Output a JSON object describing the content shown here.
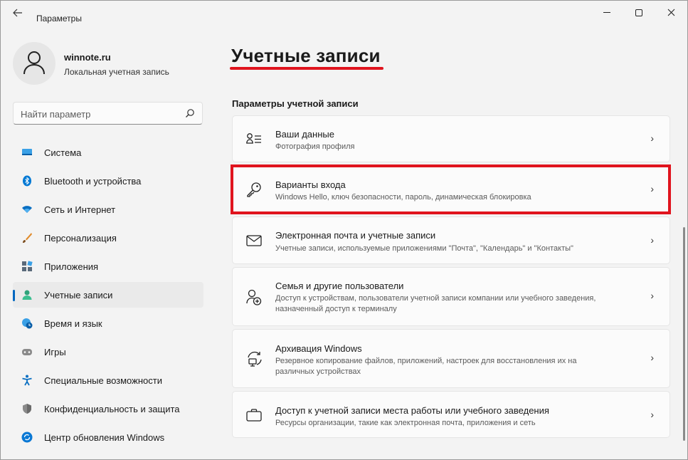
{
  "titlebar": {
    "back_icon": "back-arrow-icon",
    "title": "Параметры"
  },
  "user": {
    "name": "winnote.ru",
    "account_type": "Локальная учетная запись",
    "avatar_icon": "person-icon"
  },
  "search": {
    "placeholder": "Найти параметр",
    "icon": "search-icon"
  },
  "nav": {
    "items": [
      {
        "label": "Система",
        "icon": "system-icon",
        "color": "#0078d4"
      },
      {
        "label": "Bluetooth и устройства",
        "icon": "bluetooth-icon",
        "color": "#0078d4"
      },
      {
        "label": "Сеть и Интернет",
        "icon": "wifi-icon",
        "color": "#0078d4"
      },
      {
        "label": "Персонализация",
        "icon": "brush-icon",
        "color": "#e08a2a"
      },
      {
        "label": "Приложения",
        "icon": "apps-icon",
        "color": "#5a6a7a"
      },
      {
        "label": "Учетные записи",
        "icon": "accounts-icon",
        "color": "#2fa37a",
        "active": true
      },
      {
        "label": "Время и язык",
        "icon": "time-language-icon",
        "color": "#0078d4"
      },
      {
        "label": "Игры",
        "icon": "gamepad-icon",
        "color": "#7a7a7a"
      },
      {
        "label": "Специальные возможности",
        "icon": "accessibility-icon",
        "color": "#0078d4"
      },
      {
        "label": "Конфиденциальность и защита",
        "icon": "shield-icon",
        "color": "#7a7a7a"
      },
      {
        "label": "Центр обновления Windows",
        "icon": "update-icon",
        "color": "#0078d4"
      }
    ]
  },
  "main": {
    "title": "Учетные записи",
    "section_title": "Параметры учетной записи",
    "cards": [
      {
        "title": "Ваши данные",
        "desc": "Фотография профиля",
        "icon": "user-info-icon"
      },
      {
        "title": "Варианты входа",
        "desc": "Windows Hello, ключ безопасности, пароль, динамическая блокировка",
        "icon": "key-icon",
        "highlighted": true
      },
      {
        "title": "Электронная почта и учетные записи",
        "desc": "Учетные записи, используемые приложениями \"Почта\", \"Календарь\" и \"Контакты\"",
        "icon": "mail-icon"
      },
      {
        "title": "Семья и другие пользователи",
        "desc": "Доступ к устройствам, пользователи учетной записи компании или учебного заведения, назначенный доступ к терминалу",
        "icon": "family-icon"
      },
      {
        "title": "Архивация Windows",
        "desc": "Резервное копирование файлов, приложений, настроек для восстановления их на различных устройствах",
        "icon": "backup-icon"
      },
      {
        "title": "Доступ к учетной записи места работы или учебного заведения",
        "desc": "Ресурсы организации, такие как электронная почта, приложения и сеть",
        "icon": "briefcase-icon"
      }
    ],
    "chevron": "›"
  },
  "colors": {
    "accent": "#0067c0",
    "highlight_red": "#e0141e",
    "background": "#f3f3f3",
    "card": "#fbfbfb"
  }
}
